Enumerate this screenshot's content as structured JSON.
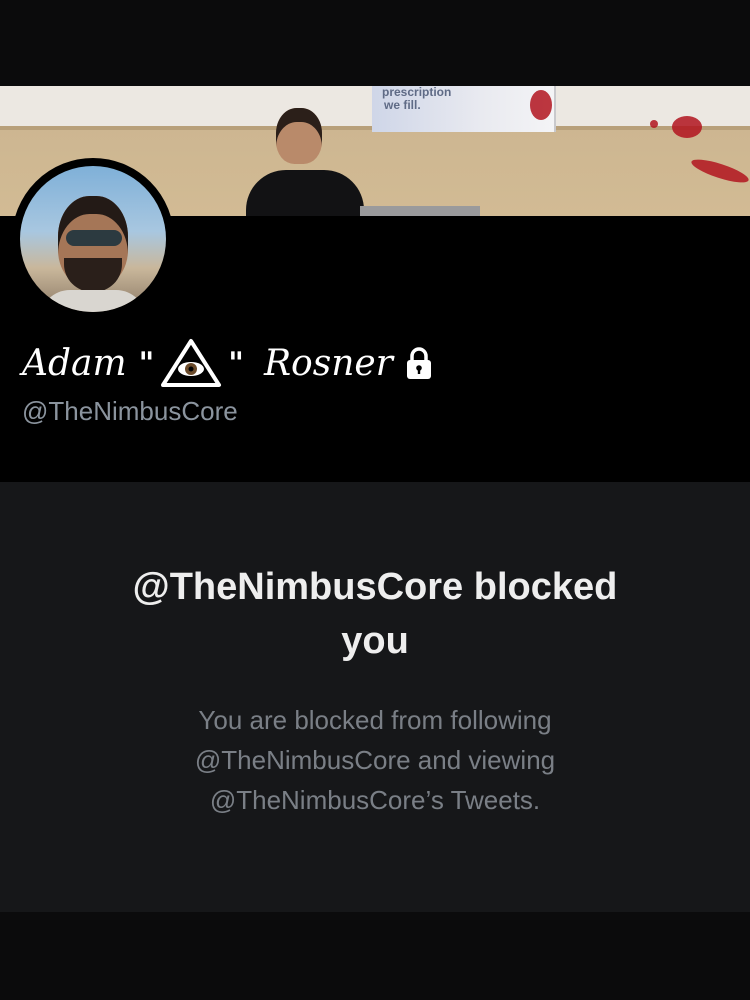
{
  "banner": {
    "poster_lines": [
      "prescription",
      "we fill."
    ]
  },
  "profile": {
    "name_first": "Adam",
    "quote_open": "\"",
    "quote_close": "\"",
    "name_last": "Rosner",
    "handle": "@TheNimbusCore",
    "icons": [
      "illuminati-eye-icon",
      "lock-icon"
    ]
  },
  "blocked": {
    "title_line1": "@TheNimbusCore blocked",
    "title_line2": "you",
    "message_line1": "You are blocked from following",
    "message_line2": "@TheNimbusCore and viewing",
    "message_line3": "@TheNimbusCore’s Tweets."
  },
  "colors": {
    "background": "#161719",
    "header": "#000000",
    "title_text": "#eeeeee",
    "muted_text": "#7a7f86"
  }
}
